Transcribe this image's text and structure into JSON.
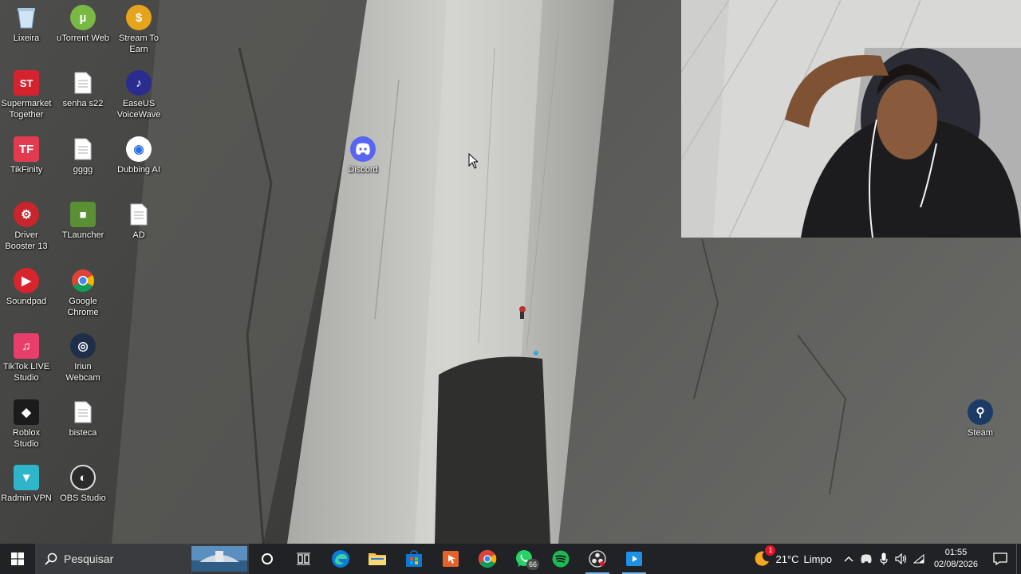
{
  "desktop": {
    "icons": [
      {
        "label": "Lixeira",
        "icon": "recycle-bin-icon"
      },
      {
        "label": "uTorrent Web",
        "icon": "utorrent-icon"
      },
      {
        "label": "Stream To\nEarn",
        "icon": "stream-to-earn-icon"
      },
      {
        "label": "Supermarket\nTogether",
        "icon": "supermarket-together-icon"
      },
      {
        "label": "senha s22",
        "icon": "text-file-icon"
      },
      {
        "label": "EaseUS\nVoiceWave",
        "icon": "easeus-voicewave-icon"
      },
      {
        "label": "TikFinity",
        "icon": "tikfinity-icon"
      },
      {
        "label": "gggg",
        "icon": "text-file-icon"
      },
      {
        "label": "Dubbing AI",
        "icon": "dubbing-ai-icon"
      },
      {
        "label": "Discord",
        "icon": "discord-icon"
      },
      {
        "label": "Driver\nBooster 13",
        "icon": "driver-booster-icon"
      },
      {
        "label": "TLauncher",
        "icon": "tlauncher-icon"
      },
      {
        "label": "AD",
        "icon": "text-file-icon"
      },
      {
        "label": "Soundpad",
        "icon": "soundpad-icon"
      },
      {
        "label": "Google\nChrome",
        "icon": "chrome-icon"
      },
      {
        "label": "TikTok LIVE\nStudio",
        "icon": "tiktok-live-studio-icon"
      },
      {
        "label": "Iriun\nWebcam",
        "icon": "iriun-webcam-icon"
      },
      {
        "label": "Roblox\nStudio",
        "icon": "roblox-studio-icon"
      },
      {
        "label": "bisteca",
        "icon": "text-file-icon"
      },
      {
        "label": "Radmin VPN",
        "icon": "radmin-vpn-icon"
      },
      {
        "label": "OBS Studio",
        "icon": "obs-studio-icon"
      },
      {
        "label": "Steam",
        "icon": "steam-icon"
      }
    ]
  },
  "taskbar": {
    "search_placeholder": "Pesquisar",
    "apps": [
      {
        "name": "cortana",
        "icon": "cortana-circle-icon"
      },
      {
        "name": "task-view",
        "icon": "task-view-icon"
      },
      {
        "name": "edge",
        "icon": "edge-icon"
      },
      {
        "name": "file-explorer",
        "icon": "folder-icon"
      },
      {
        "name": "microsoft-store",
        "icon": "store-icon"
      },
      {
        "name": "app-orange",
        "icon": "orange-app-icon"
      },
      {
        "name": "chrome",
        "icon": "chrome-icon"
      },
      {
        "name": "whatsapp",
        "icon": "whatsapp-icon",
        "badge": "66"
      },
      {
        "name": "spotify",
        "icon": "spotify-icon"
      },
      {
        "name": "obs",
        "icon": "obs-studio-icon"
      },
      {
        "name": "media-app",
        "icon": "media-app-icon"
      }
    ],
    "weather": {
      "temp": "21°C",
      "condition": "Limpo",
      "badge": "1"
    },
    "clock": {
      "time": "01:55",
      "date": "02/08/2026"
    }
  },
  "colors": {
    "taskbar_bg": "#202225",
    "accent": "#76b9ed",
    "discord": "#5865f2",
    "spotify": "#1db954",
    "whatsapp": "#25d366"
  }
}
